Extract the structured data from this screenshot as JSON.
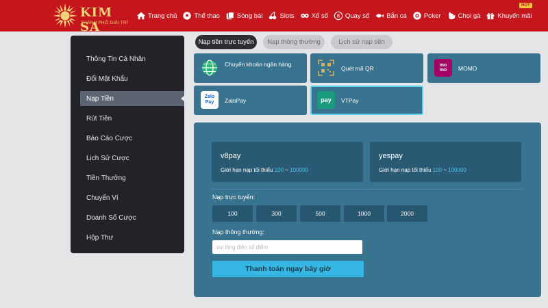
{
  "brand": {
    "name": "KIM SA",
    "tagline": "THÀNH PHỐ GIẢI TRÍ",
    "color_primary": "#c4161c",
    "color_gold": "#f4d27a"
  },
  "nav": {
    "items": [
      {
        "label": "Trang chủ",
        "icon": "home-icon"
      },
      {
        "label": "Thể thao",
        "icon": "soccer-ball-icon"
      },
      {
        "label": "Sòng bài",
        "icon": "casino-icon"
      },
      {
        "label": "Slots",
        "icon": "cherries-icon"
      },
      {
        "label": "Xổ số",
        "icon": "lottery-icon"
      },
      {
        "label": "Quay số",
        "icon": "number-ball-icon"
      },
      {
        "label": "Bắn cá",
        "icon": "fish-icon"
      },
      {
        "label": "Poker",
        "icon": "poker-chip-icon"
      },
      {
        "label": "Chọi gà",
        "icon": "rooster-icon"
      },
      {
        "label": "Khuyến mãi",
        "icon": "gift-icon"
      }
    ],
    "hot_badge": "HOT"
  },
  "sidebar": {
    "items": [
      {
        "label": "Thông Tin Cá Nhân"
      },
      {
        "label": "Đổi Mật Khẩu"
      },
      {
        "label": "Nạp Tiền",
        "active": true
      },
      {
        "label": "Rút Tiền"
      },
      {
        "label": "Báo Cáo Cược"
      },
      {
        "label": "Lịch Sử Cược"
      },
      {
        "label": "Tiền Thưởng"
      },
      {
        "label": "Chuyển Ví"
      },
      {
        "label": "Doanh Số Cược"
      },
      {
        "label": "Hộp Thư"
      }
    ]
  },
  "tabs": [
    {
      "label": "Nạp tiền trực tuyến",
      "active": true
    },
    {
      "label": "Nạp thông thường",
      "active": false
    },
    {
      "label": "Lịch sử nạp tiền",
      "active": false
    }
  ],
  "methods": [
    {
      "label": "Chuyển khoản ngân hàng",
      "icon": "globe-icon"
    },
    {
      "label": "Quét mã QR",
      "icon": "qr-code-icon"
    },
    {
      "label": "MOMO",
      "icon": "momo-logo-icon",
      "icon_text": "mo mo"
    },
    {
      "label": "ZaloPay",
      "icon": "zalopay-logo-icon",
      "icon_text": "Zalo Pay"
    },
    {
      "label": "VTPay",
      "icon": "vtpay-logo-icon",
      "icon_text": "pay",
      "selected": true
    }
  ],
  "gateways": [
    {
      "name": "v8pay",
      "limit_label": "Giới hạn nạp tối thiểu",
      "min": "100",
      "sep": "~",
      "max": "100000"
    },
    {
      "name": "yespay",
      "limit_label": "Giới hạn nạp tối thiểu",
      "min": "100",
      "sep": "~",
      "max": "100000"
    }
  ],
  "online_section": {
    "label": "Nạp trực tuyến:",
    "amounts": [
      "100",
      "300",
      "500",
      "1000",
      "2000"
    ]
  },
  "normal_section": {
    "label": "Nạp thông thường:",
    "placeholder": "vui lòng điền số điểm"
  },
  "submit_label": "Thanh toán ngay bây giờ"
}
